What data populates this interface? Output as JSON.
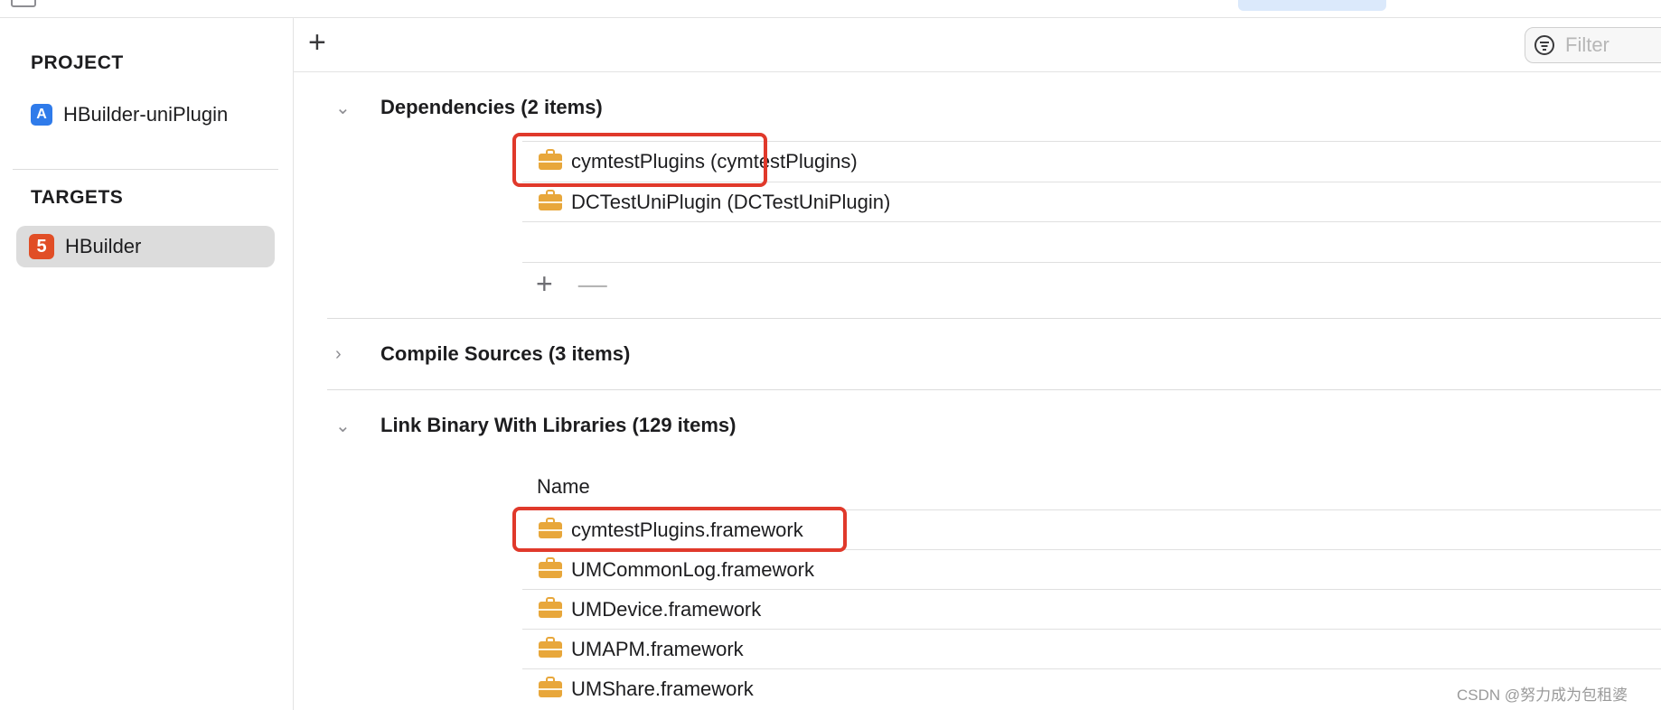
{
  "sidebar": {
    "project_heading": "PROJECT",
    "project_name": "HBuilder-uniPlugin",
    "project_icon": "xcode-app-icon",
    "targets_heading": "TARGETS",
    "target_name": "HBuilder",
    "target_icon": "html5-icon"
  },
  "toolbar": {
    "add_label": "+",
    "filter_placeholder": "Filter"
  },
  "phases": {
    "dependencies": {
      "title": "Dependencies (2 items)",
      "items": [
        "cymtestPlugins (cymtestPlugins)",
        "DCTestUniPlugin (DCTestUniPlugin)"
      ],
      "add_label": "+",
      "remove_label": "—"
    },
    "compile_sources": {
      "title": "Compile Sources (3 items)"
    },
    "link_binary": {
      "title": "Link Binary With Libraries (129 items)",
      "column_header": "Name",
      "items": [
        "cymtestPlugins.framework",
        "UMCommonLog.framework",
        "UMDevice.framework",
        "UMAPM.framework",
        "UMShare.framework"
      ]
    }
  },
  "watermark": "CSDN @努力成为包租婆",
  "colors": {
    "highlight": "#e0392b",
    "framework_icon": "#e8a73b",
    "selection": "#dcdcdc"
  }
}
